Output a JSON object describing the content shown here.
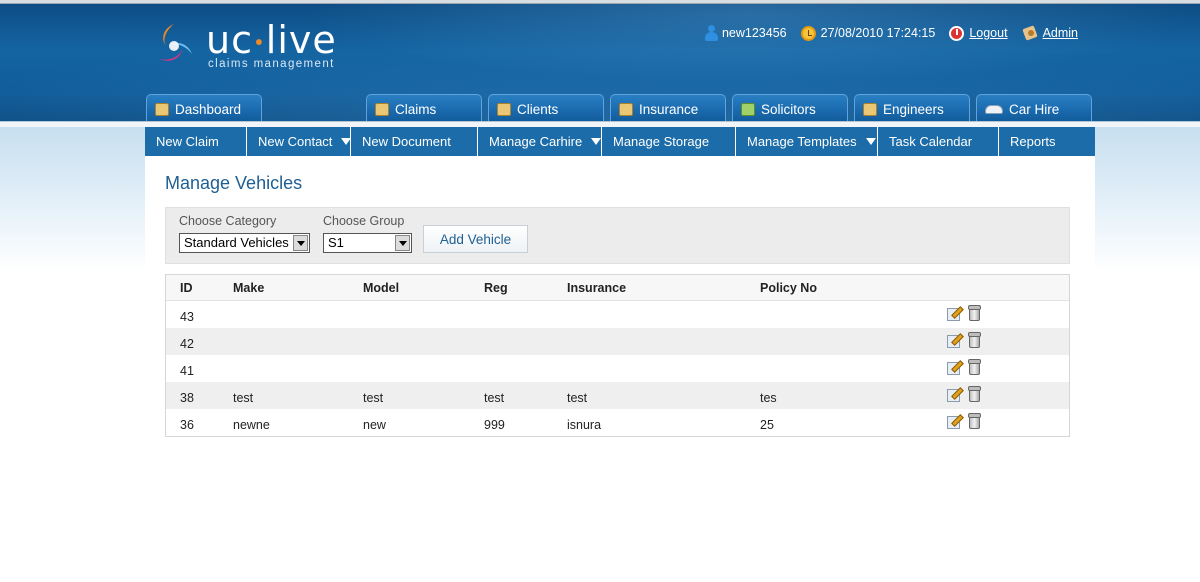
{
  "header": {
    "brand": "uc",
    "brand_dot": "•",
    "brand_suffix": "live",
    "tagline": "claims management",
    "username": "new123456",
    "datetime": "27/08/2010 17:24:15",
    "logout_label": "Logout",
    "admin_label": "Admin"
  },
  "main_tabs": [
    {
      "label": "Dashboard",
      "icon": "dashboard-icon"
    },
    {
      "label": "Claims",
      "icon": "folder-icon"
    },
    {
      "label": "Clients",
      "icon": "clients-icon"
    },
    {
      "label": "Insurance",
      "icon": "insurance-icon"
    },
    {
      "label": "Solicitors",
      "icon": "solicitors-icon"
    },
    {
      "label": "Engineers",
      "icon": "engineers-icon"
    },
    {
      "label": "Car Hire",
      "icon": "car-icon"
    }
  ],
  "sub_nav": [
    {
      "label": "New Claim",
      "dropdown": false
    },
    {
      "label": "New Contact",
      "dropdown": true
    },
    {
      "label": "New Document",
      "dropdown": false
    },
    {
      "label": "Manage Carhire",
      "dropdown": true
    },
    {
      "label": "Manage Storage",
      "dropdown": false
    },
    {
      "label": "Manage Templates",
      "dropdown": true
    },
    {
      "label": "Task Calendar",
      "dropdown": false
    },
    {
      "label": "Reports",
      "dropdown": false
    }
  ],
  "page": {
    "title": "Manage Vehicles",
    "category_label": "Choose Category",
    "category_value": "Standard Vehicles",
    "group_label": "Choose Group",
    "group_value": "S1",
    "add_button": "Add Vehicle"
  },
  "table": {
    "columns": [
      "ID",
      "Make",
      "Model",
      "Reg",
      "Insurance",
      "Policy No"
    ],
    "rows": [
      {
        "id": "43",
        "make": "",
        "model": "",
        "reg": "",
        "insurance": "",
        "policy": ""
      },
      {
        "id": "42",
        "make": "",
        "model": "",
        "reg": "",
        "insurance": "",
        "policy": ""
      },
      {
        "id": "41",
        "make": "",
        "model": "",
        "reg": "",
        "insurance": "",
        "policy": ""
      },
      {
        "id": "38",
        "make": "test",
        "model": "test",
        "reg": "test",
        "insurance": "test",
        "policy": "tes"
      },
      {
        "id": "36",
        "make": "newne",
        "model": "new",
        "reg": "999",
        "insurance": "isnura",
        "policy": "25"
      }
    ]
  },
  "colors": {
    "header_blue": "#1565a3",
    "subnav_blue": "#1b6ca8",
    "title_blue": "#1e5f94",
    "accent_orange": "#f08a24"
  }
}
